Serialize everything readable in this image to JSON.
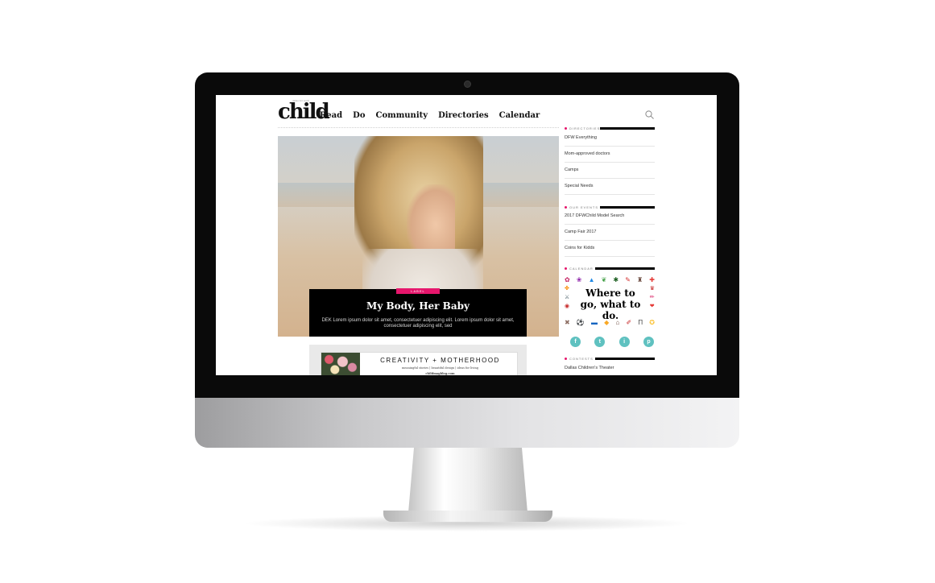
{
  "site": {
    "logo_text": "child",
    "logo_small": "dallas fort worth"
  },
  "nav": {
    "items": [
      "Read",
      "Do",
      "Community",
      "Directories",
      "Calendar"
    ]
  },
  "hero": {
    "label": "LABEL",
    "title": "My Body, Her Baby",
    "dek": "DEK Lorem ipsum dolor sit amet, consectetuer adipiscing elit. Lorem ipsum dolor sit amet, consectetuer adipiscing elit, sed"
  },
  "ad": {
    "title": "CREATIVITY + MOTHERHOOD",
    "subtitle": "meaningful stories  |  beautiful design  |  ideas for living",
    "url": "childmagblog.com"
  },
  "sidebar": {
    "directories": {
      "heading": "DIRECTORIES",
      "items": [
        "DFW Everything",
        "Mom-approved doctors",
        "Camps",
        "Special Needs"
      ]
    },
    "events": {
      "heading": "OUR EVENTS",
      "items": [
        "2017 DFWChild Model Search",
        "Camp Fair 2017",
        "Coins for Kidds"
      ]
    },
    "calendar": {
      "heading": "CALENDAR",
      "text": "Where to go, what to do."
    },
    "social": [
      "f",
      "t",
      "i",
      "p"
    ],
    "contests": {
      "heading": "CONTESTS",
      "items": [
        "Dallas Children's Theater"
      ]
    }
  },
  "colors": {
    "accent": "#e6166c",
    "social": "#5fc1c0"
  }
}
